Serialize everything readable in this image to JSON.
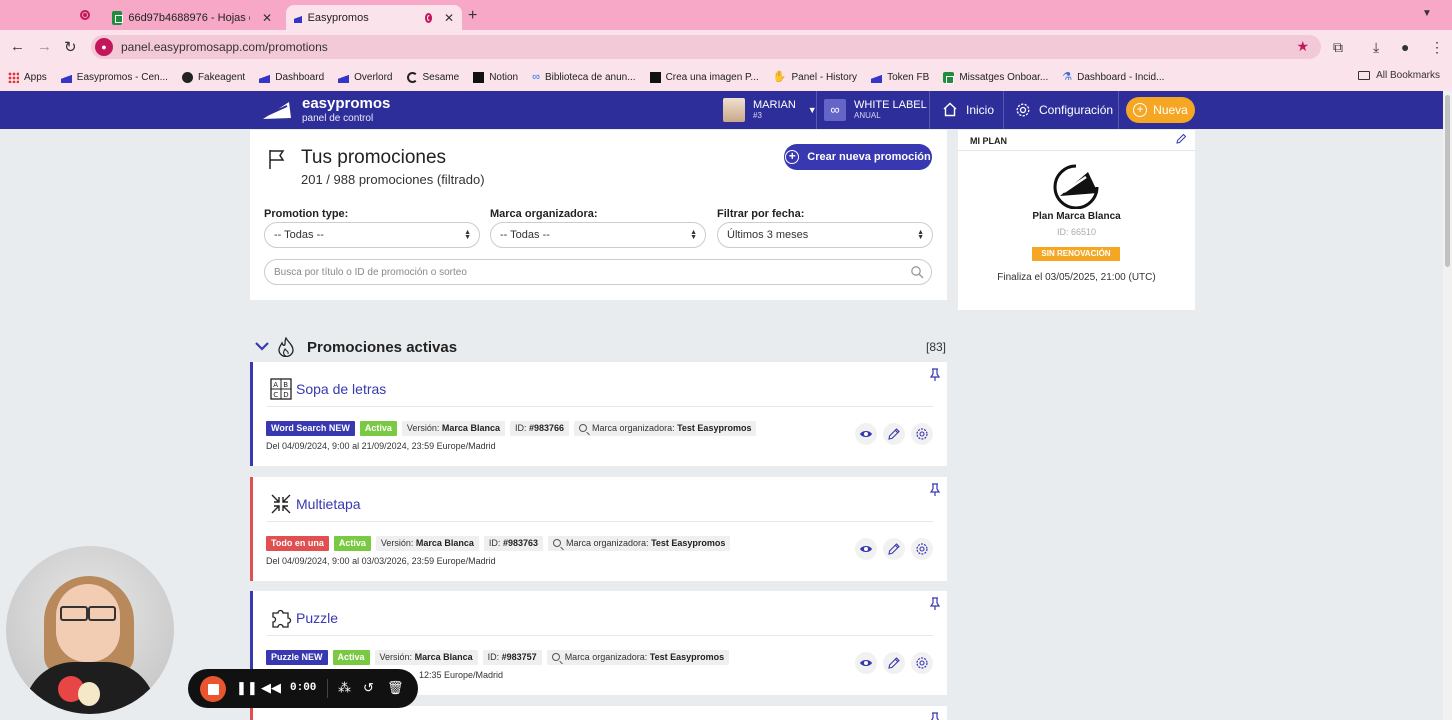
{
  "browser": {
    "tabs": [
      {
        "title": "66d97b4688976 - Hojas de c",
        "active": false
      },
      {
        "title": "Easypromos",
        "active": true
      }
    ],
    "url": "panel.easypromosapp.com/promotions",
    "bookmarks": [
      "Apps",
      "Easypromos - Cen...",
      "Fakeagent",
      "Dashboard",
      "Overlord",
      "Sesame",
      "Notion",
      "Biblioteca de anun...",
      "Crea una imagen P...",
      "Panel - History",
      "Token FB",
      "Missatges Onboar...",
      "Dashboard - Incid..."
    ],
    "all_bookmarks": "All Bookmarks"
  },
  "header": {
    "brand": "easypromos",
    "brand_sub": "panel de control",
    "user_name": "MARIAN",
    "user_sub": "#3",
    "plan_label": "WHITE LABEL",
    "plan_sub": "ANUAL",
    "nav_home": "Inicio",
    "nav_config": "Configuración",
    "new_button": "Nueva"
  },
  "filters": {
    "title": "Tus promociones",
    "count": "201 / 988 promociones (filtrado)",
    "create_button": "Crear nueva promoción",
    "promotion_type_label": "Promotion type:",
    "promotion_type_value": "-- Todas --",
    "brand_label": "Marca organizadora:",
    "brand_value": "-- Todas --",
    "date_label": "Filtrar por fecha:",
    "date_value": "Últimos 3 meses",
    "search_placeholder": "Busca por título o ID de promoción o sorteo"
  },
  "my_plan": {
    "heading": "MI PLAN",
    "name": "Plan Marca Blanca",
    "id": "ID: 66510",
    "badge": "SIN RENOVACIÓN",
    "ends": "Finaliza el 03/05/2025, 21:00 (UTC)"
  },
  "section": {
    "title": "Promociones activas",
    "count": "[83]"
  },
  "promotions": [
    {
      "title": "Sopa de letras",
      "type_tag": "Word Search NEW",
      "status": "Activa",
      "version_label": "Versión:",
      "version": "Marca Blanca",
      "id_label": "ID:",
      "id": "#983766",
      "brand_label": "Marca organizadora:",
      "brand": "Test Easypromos",
      "dates": "Del 04/09/2024, 9:00 al 21/09/2024, 23:59 Europe/Madrid"
    },
    {
      "title": "Multietapa",
      "type_tag": "Todo en una",
      "status": "Activa",
      "version_label": "Versión:",
      "version": "Marca Blanca",
      "id_label": "ID:",
      "id": "#983763",
      "brand_label": "Marca organizadora:",
      "brand": "Test Easypromos",
      "dates": "Del 04/09/2024, 9:00 al 03/03/2026, 23:59 Europe/Madrid"
    },
    {
      "title": "Puzzle",
      "type_tag": "Puzzle NEW",
      "status": "Activa",
      "version_label": "Versión:",
      "version": "Marca Blanca",
      "id_label": "ID:",
      "id": "#983757",
      "brand_label": "Marca organizadora:",
      "brand": "Test Easypromos",
      "dates": "12:35 Europe/Madrid"
    }
  ],
  "recorder": {
    "time": "0:00"
  },
  "colors": {
    "primary": "#2e2e9b",
    "accent": "#f5a623",
    "active_green": "#7ac943",
    "alert_red": "#e05050",
    "browser_pink": "#f7a8c6"
  }
}
